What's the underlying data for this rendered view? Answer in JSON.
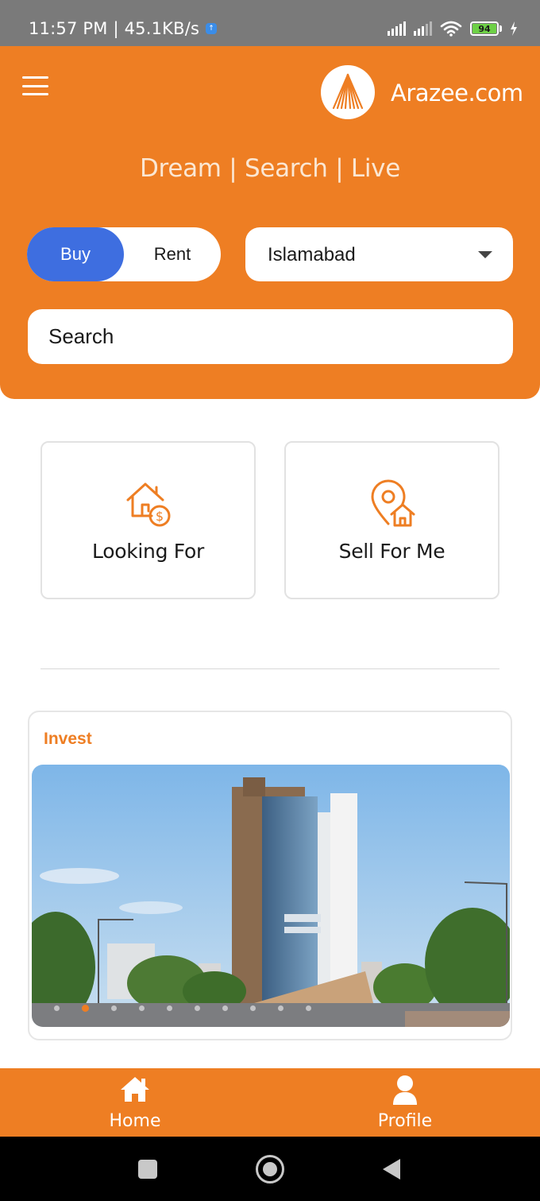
{
  "status_bar": {
    "left_text": "11:57 PM | 45.1KB/s",
    "battery_level": "94"
  },
  "header": {
    "brand_name": "Arazee.com",
    "tagline": "Dream | Search | Live",
    "buy_label": "Buy",
    "rent_label": "Rent",
    "selected_mode": "Buy",
    "city": "Islamabad",
    "search_placeholder": "Search",
    "accent_color": "#ee7e23",
    "toggle_active_color": "#3e6ee0"
  },
  "actions": {
    "looking_for_label": "Looking For",
    "sell_for_me_label": "Sell For Me"
  },
  "invest": {
    "title": "Invest",
    "carousel_active_index": 1,
    "carousel_count": 10
  },
  "bottom_nav": {
    "home_label": "Home",
    "profile_label": "Profile"
  },
  "icons": {
    "menu": "hamburger-menu-icon",
    "logo": "arazee-logo",
    "looking_for": "house-dollar-icon",
    "sell_for_me": "location-house-icon",
    "home": "home-icon",
    "profile": "user-icon"
  }
}
